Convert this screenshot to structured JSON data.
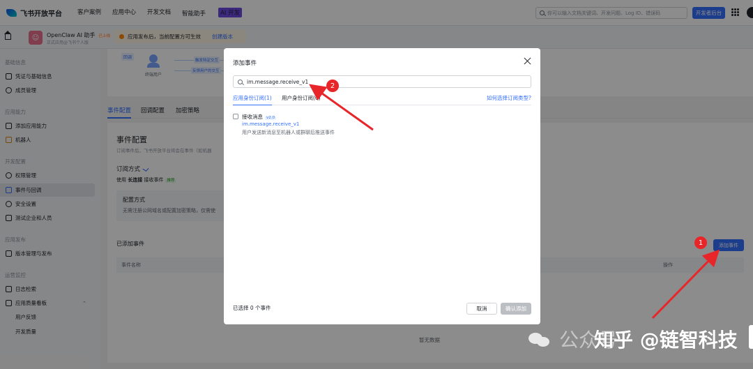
{
  "topbar": {
    "brand": "飞书开放平台",
    "nav": [
      "客户案例",
      "应用中心",
      "开发文档",
      "智能助手"
    ],
    "ai_tag": "AI 开发",
    "search_placeholder": "你可以输入文档关键词、开发问题、Log ID、错误码",
    "dev_console": "开发者后台"
  },
  "appbar": {
    "app_name": "OpenClaw AI 助手",
    "online_tag": "已上线",
    "app_sub": "正式应用@飞书个人版",
    "notice": "应用发布后，当前配置方可生效",
    "notice_link": "创建版本"
  },
  "sidebar": {
    "sections": {
      "basic": "基础信息",
      "ability": "应用能力",
      "dev": "开发配置",
      "publish": "应用发布",
      "ops": "运营监控"
    },
    "items": {
      "credentials": "凭证与基础信息",
      "members": "成员管理",
      "add_ability": "添加应用能力",
      "bot": "机器人",
      "permissions": "权限管理",
      "events": "事件与回调",
      "security": "安全设置",
      "test_org": "测试企业和人员",
      "versions": "版本管理与发布",
      "logs": "日志检索",
      "quality": "应用质量看板",
      "feedback": "用户反馈",
      "dev_quality": "开发质量"
    }
  },
  "diagram": {
    "push_tag": "回调",
    "user_label": "终端用户",
    "flow1": "触发特定交互",
    "flow2": "反馈用户的交互"
  },
  "tabs": [
    "事件配置",
    "回调配置",
    "加密策略"
  ],
  "content": {
    "title": "事件配置",
    "desc": "订阅事件后，飞书开放平台将会在事件（如机器",
    "sub_title": "订阅方式",
    "use_prefix": "使用 ",
    "use_bold": "长连接",
    "use_suffix": " 接收事件",
    "rec_tag": "推荐",
    "conf_title": "配置方式",
    "conf_desc": "无需注册公网域名或配置加密策略，仅需使",
    "added_title": "已添加事件",
    "add_button": "添加事件",
    "col_name": "事件名称",
    "col_op": "操作",
    "empty": "暂无数据"
  },
  "modal": {
    "title": "添加事件",
    "search_value": "im.message.receive_v1",
    "tab_app": "应用身份订阅(1)",
    "tab_user": "用户身份订阅(0)",
    "help_link": "如何选择订阅类型?",
    "event": {
      "name": "接收消息",
      "version": "v2.0",
      "key": "im.message.receive_v1",
      "desc": "用户发送新消息至机器人或群聊后推送事件"
    },
    "selected": "已选择 0 个事件",
    "cancel": "取消",
    "confirm": "确认添加"
  },
  "annotations": {
    "badge1": "1",
    "badge2": "2",
    "color": "#e8262a"
  },
  "watermark": {
    "faint": "公众号",
    "text": "知乎 @链智科技"
  },
  "colors": {
    "primary": "#3370ff",
    "overlay": "rgba(0,0,0,0.45)"
  }
}
